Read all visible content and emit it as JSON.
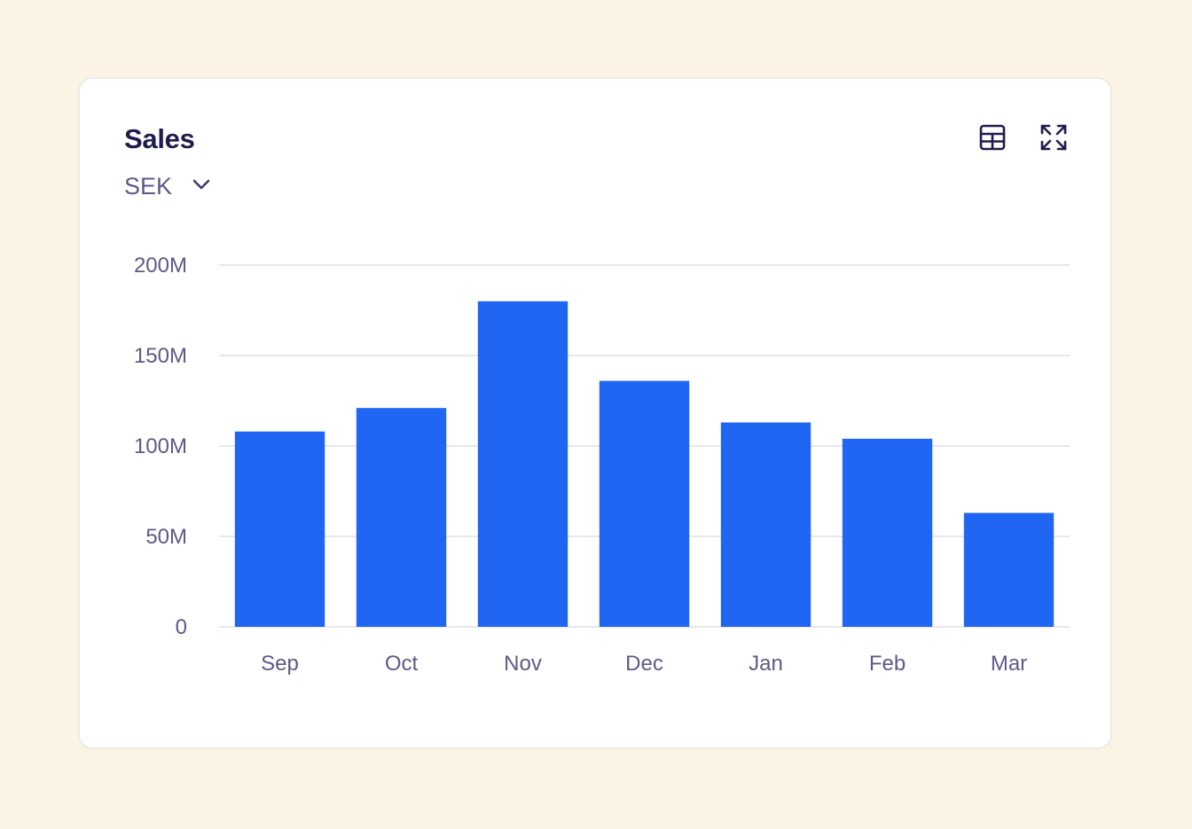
{
  "card": {
    "title": "Sales",
    "currency": {
      "selected": "SEK",
      "icon": "chevron-down-icon"
    },
    "actions": [
      {
        "icon": "table-icon"
      },
      {
        "icon": "expand-icon"
      }
    ]
  },
  "colors": {
    "page_background": "#FBF4E4",
    "card_background": "#FFFFFF",
    "bar": "#2165F3",
    "title": "#1F1B4D",
    "muted_text": "#5D5A87",
    "gridline": "#E8E7EE"
  },
  "chart_data": {
    "type": "bar",
    "title": "Sales",
    "xlabel": "",
    "ylabel": "",
    "categories": [
      "Sep",
      "Oct",
      "Nov",
      "Dec",
      "Jan",
      "Feb",
      "Mar"
    ],
    "values": [
      108,
      121,
      180,
      136,
      113,
      104,
      63
    ],
    "ylim": [
      0,
      200
    ],
    "yticks": [
      0,
      50,
      100,
      150,
      200
    ],
    "ytick_labels": [
      "0",
      "50M",
      "100M",
      "150M",
      "200M"
    ],
    "grid": true,
    "legend": "none"
  }
}
